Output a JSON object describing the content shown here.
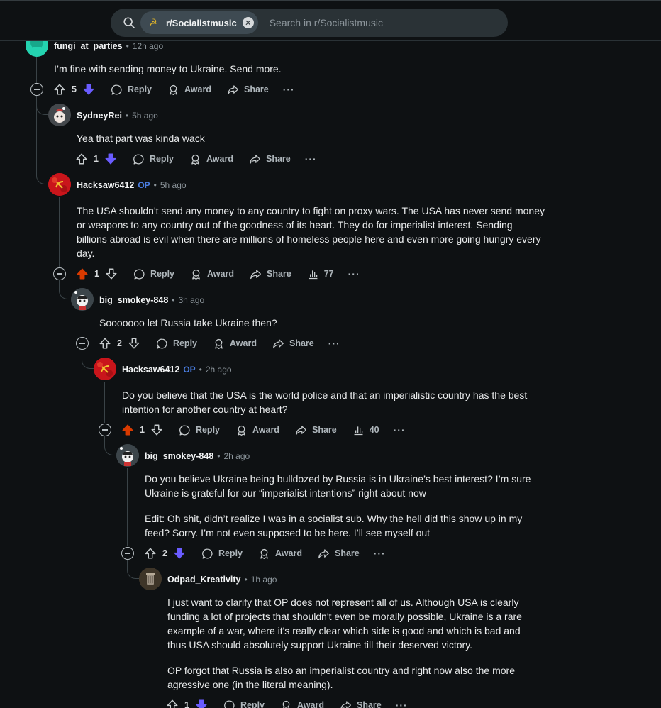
{
  "header": {
    "subreddit": "r/Socialistmusic",
    "search_placeholder": "Search in r/Socialistmusic"
  },
  "colors": {
    "upvoted": "#d93a00",
    "downvoted": "#6a5cff",
    "op_tag": "#4a7de0",
    "background": "#0e1113"
  },
  "actions": {
    "reply": "Reply",
    "award": "Award",
    "share": "Share",
    "more": "···"
  },
  "comments": [
    {
      "author": "fungi_at_parties",
      "time": "12h ago",
      "op": "",
      "body": [
        "I’m fine with sending money to Ukraine. Send more."
      ],
      "score": "5",
      "vote": "down"
    },
    {
      "author": "SydneyRei",
      "time": "5h ago",
      "op": "",
      "body": [
        "Yea that part was kinda wack"
      ],
      "score": "1",
      "vote": "down"
    },
    {
      "author": "Hacksaw6412",
      "time": "5h ago",
      "op": "OP",
      "body": [
        "The USA shouldn't send any money to any country to fight on proxy wars. The USA has never send money or weapons to any country out of the goodness of its heart. They do for imperialist interest. Sending billions abroad is evil when there are millions of homeless people here and even more going hungry every day."
      ],
      "score": "1",
      "vote": "up",
      "views": "77"
    },
    {
      "author": "big_smokey-848",
      "time": "3h ago",
      "op": "",
      "body": [
        "Sooooooo let Russia take Ukraine then?"
      ],
      "score": "2",
      "vote": "none"
    },
    {
      "author": "Hacksaw6412",
      "time": "2h ago",
      "op": "OP",
      "body": [
        "Do you believe that the USA is the world police and that an imperialistic country has the best intention for another country at heart?"
      ],
      "score": "1",
      "vote": "up",
      "views": "40"
    },
    {
      "author": "big_smokey-848",
      "time": "2h ago",
      "op": "",
      "body": [
        "Do you believe Ukraine being bulldozed by Russia is in Ukraine’s best interest? I’m sure Ukraine is grateful for our “imperialist intentions” right about now",
        "Edit: Oh shit, didn’t realize I was in a socialist sub. Why the hell did this show up in my feed? Sorry. I’m not even supposed to be here. I’ll see myself out"
      ],
      "score": "2",
      "vote": "down"
    },
    {
      "author": "Odpad_Kreativity",
      "time": "1h ago",
      "op": "",
      "body": [
        "I just want to clarify that OP does not represent all of us. Although USA is clearly funding a lot of projects that shouldn't even be morally possible, Ukraine is a rare example of a war, where it's really clear which side is good and which is bad and thus USA should absolutely support Ukraine till their deserved victory.",
        "OP forgot that Russia is also an imperialist country and right now also the more agressive one (in the literal meaning)."
      ],
      "score": "1",
      "vote": "down"
    }
  ]
}
